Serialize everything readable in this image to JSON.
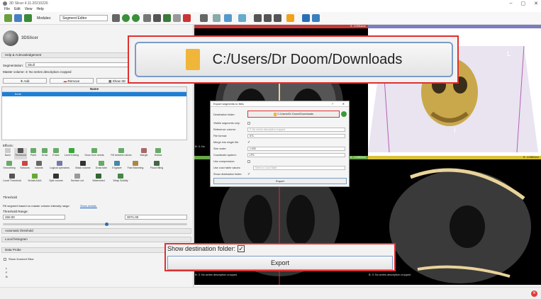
{
  "window": {
    "title": "3D Slicer 4.11.20210226",
    "menus": [
      "File",
      "Edit",
      "View",
      "Help"
    ]
  },
  "toolbar": {
    "module_label": "Modules:",
    "module_selected": "Segment Editor"
  },
  "left": {
    "logo_text": "3DSlicer",
    "help_section": "Help & Acknowledgement",
    "segmentation_label": "Segmentation:",
    "segmentation_value": "Skull",
    "master_volume_label": "Master volume:",
    "master_volume_value": "3: No series description cropped",
    "add_label": "Add",
    "remove_label": "Remove",
    "show3d_label": "Show 3D",
    "segmentations_label": "Segmentations...",
    "table_header_name": "Name",
    "segment_name": "bone",
    "effects_label": "Effects:",
    "effects": [
      "None",
      "Threshold",
      "Paint",
      "Draw",
      "Erase",
      "Level tracing",
      "Grow from seeds",
      "Fill between slices",
      "Margin",
      "Hollow",
      "Smoothing",
      "Scissors",
      "Islands",
      "Logical operators",
      "Mask volume",
      "Draw tube",
      "Engrave",
      "Fast Marching",
      "Flood filling",
      "Local Threshold",
      "Nvidia AIAA",
      "Split volume",
      "Surface cut",
      "Watershed",
      "Wrap Solidify"
    ],
    "threshold_title": "Threshold",
    "threshold_desc": "Fill segment based on master volume intensity range.",
    "show_details": "Show details.",
    "threshold_range_label": "Threshold Range:",
    "threshold_min": "450.00",
    "threshold_max": "3071.00",
    "auto_threshold": "Automatic threshold",
    "local_histogram": "Local histogram",
    "data_probe": "Data Probe",
    "show_zoomed": "Show Zoomed Slice",
    "probe_lines": [
      "L",
      "F",
      "B"
    ]
  },
  "viewers": {
    "red_coord": "S: -5.3994mm",
    "green_coord": "A: -2.0852mm",
    "yellow_coord": "R: -5.0852mm",
    "red_label": "B: 3: No",
    "yellow_label": "B: 3: No",
    "desc": "B: 3: No series description cropped",
    "orient_3d": "L",
    "orient_3d_b": "I"
  },
  "dialog": {
    "title": "Export segments to files",
    "help_btn": "?",
    "close_btn": "✕",
    "dest_label": "Destination folder:",
    "dest_value": "C:/Users/Dr Doom/Downloads",
    "visible_only": "Visible segments only:",
    "ref_volume_label": "Reference volume:",
    "ref_volume_value": "3: No series description cropped",
    "format_label": "File format:",
    "format_value": "STL",
    "merge_label": "Merge into single file:",
    "size_label": "Size scale:",
    "size_value": "1.000",
    "coord_label": "Coordinate system:",
    "coord_value": "LPS",
    "compression_label": "Use compression:",
    "color_table_label": "Use color table values:",
    "color_table_value": "Select a ColorTable",
    "show_dest_label": "Show destination folder:",
    "export_label": "Export"
  },
  "callouts": {
    "path": "C:/Users/Dr Doom/Downloads",
    "show_dest": "Show destination folder:",
    "export": "Export"
  }
}
